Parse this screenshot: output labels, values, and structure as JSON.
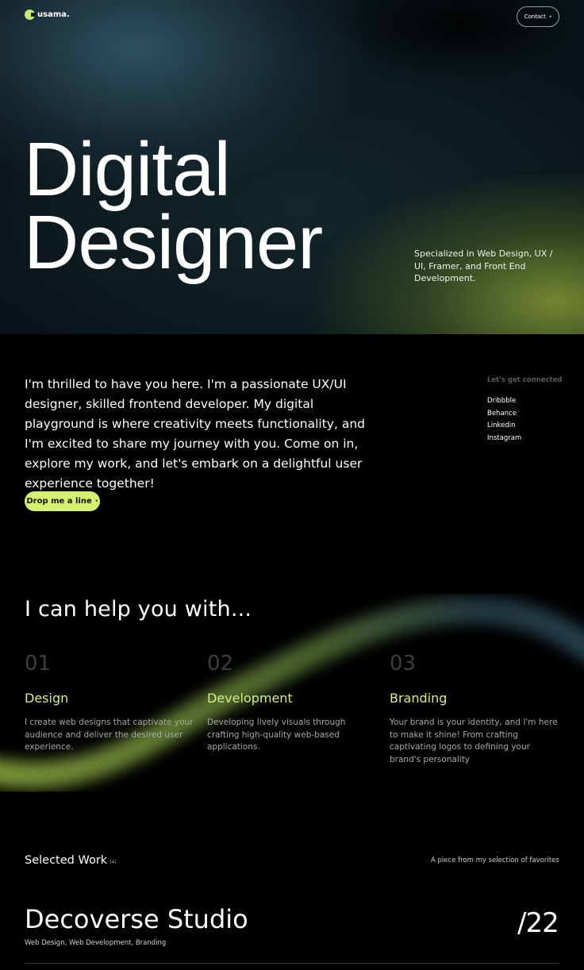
{
  "header": {
    "logo_text": "usama.",
    "contact_label": "Contact",
    "contact_dot": "•"
  },
  "hero": {
    "title_line1": "Digital",
    "title_line2": "Designer",
    "subtitle": "Specialized in Web Design, UX / UI, Framer, and Front End Development."
  },
  "intro": {
    "text": "I'm thrilled to have you here. I'm a passionate UX/UI designer, skilled frontend developer. My digital playground is where creativity meets functionality, and I'm excited to share my journey with you. Come on in, explore my work, and let's embark on a delightful user experience together!",
    "cta_label": "Drop me a line",
    "cta_dot": "•"
  },
  "connect": {
    "heading": "Let's get connected",
    "links": [
      "Dribbble",
      "Behance",
      "Linkedin",
      "Instagram"
    ]
  },
  "services": {
    "title": "I can help you with...",
    "items": [
      {
        "num": "01",
        "name": "Design",
        "desc": "I create web designs that captivate your audience and deliver the desired user experience."
      },
      {
        "num": "02",
        "name": "Development",
        "desc": "Developing lively visuals through crafting high-quality web-based applications."
      },
      {
        "num": "03",
        "name": "Branding",
        "desc": "Your brand is your identity, and I'm here to make it shine! From crafting captivating logos to defining your brand's personality"
      }
    ]
  },
  "work": {
    "heading": "Selected Work",
    "count": "(4)",
    "side_note": "A piece from my selection of favorites",
    "project": {
      "title": "Decoverse Studio",
      "tags": "Web Design, Web Development, Branding",
      "number": "/22"
    }
  },
  "colors": {
    "accent": "#d5f26f",
    "service_name": "#d3ee7c",
    "background": "#000000"
  }
}
